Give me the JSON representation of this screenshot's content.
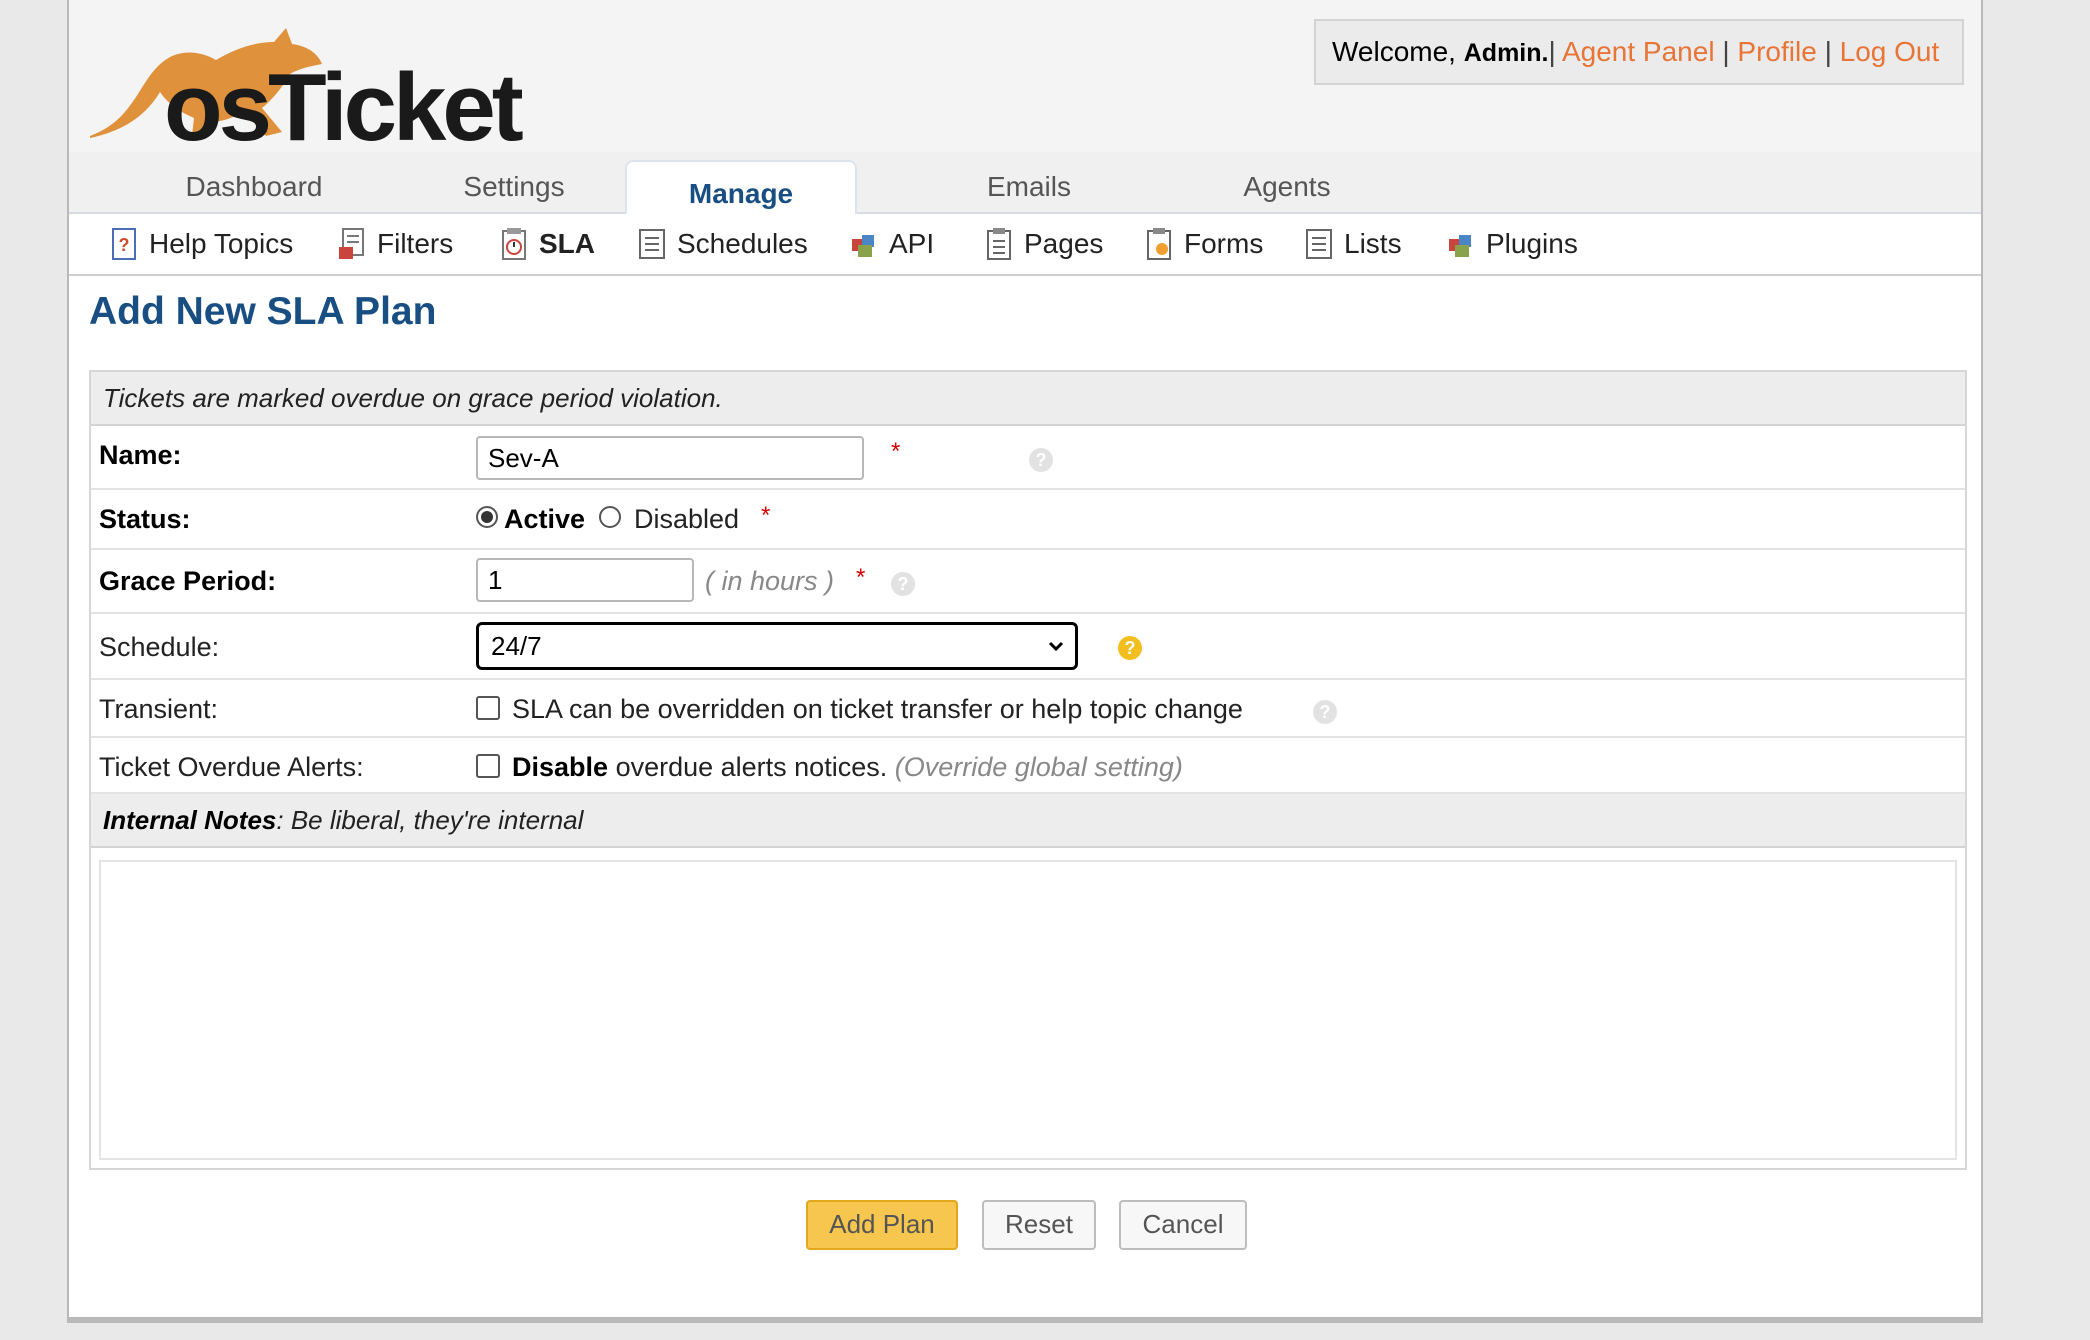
{
  "app": {
    "logo_text": "osTicket"
  },
  "userinfo": {
    "welcome": "Welcome,",
    "name": "Admin.",
    "agent_panel": "Agent Panel",
    "profile": "Profile",
    "logout": "Log Out"
  },
  "nav": {
    "tabs": [
      "Dashboard",
      "Settings",
      "Manage",
      "Emails",
      "Agents"
    ],
    "active": "Manage"
  },
  "subnav": {
    "items": [
      "Help Topics",
      "Filters",
      "SLA",
      "Schedules",
      "API",
      "Pages",
      "Forms",
      "Lists",
      "Plugins"
    ],
    "active": "SLA"
  },
  "page": {
    "title": "Add New SLA Plan",
    "header_note": "Tickets are marked overdue on grace period violation."
  },
  "form": {
    "name": {
      "label": "Name:",
      "value": "Sev-A"
    },
    "status": {
      "label": "Status:",
      "active": "Active",
      "disabled": "Disabled",
      "selected": "Active"
    },
    "grace": {
      "label": "Grace Period:",
      "value": "1",
      "hint": "( in hours )"
    },
    "schedule": {
      "label": "Schedule:",
      "value": "24/7"
    },
    "transient": {
      "label": "Transient:",
      "text": "SLA can be overridden on ticket transfer or help topic change",
      "checked": false
    },
    "alerts": {
      "label": "Ticket Overdue Alerts:",
      "bold": "Disable",
      "text": "overdue alerts notices.",
      "note": "(Override global setting)",
      "checked": false
    },
    "notes": {
      "title": "Internal Notes",
      "subtitle": ": Be liberal, they're internal",
      "value": ""
    },
    "required": "*",
    "help": "?"
  },
  "buttons": {
    "add": "Add Plan",
    "reset": "Reset",
    "cancel": "Cancel"
  },
  "colors": {
    "brand": "#e87436",
    "title": "#184e81",
    "primary_button": "#f6c64f"
  }
}
